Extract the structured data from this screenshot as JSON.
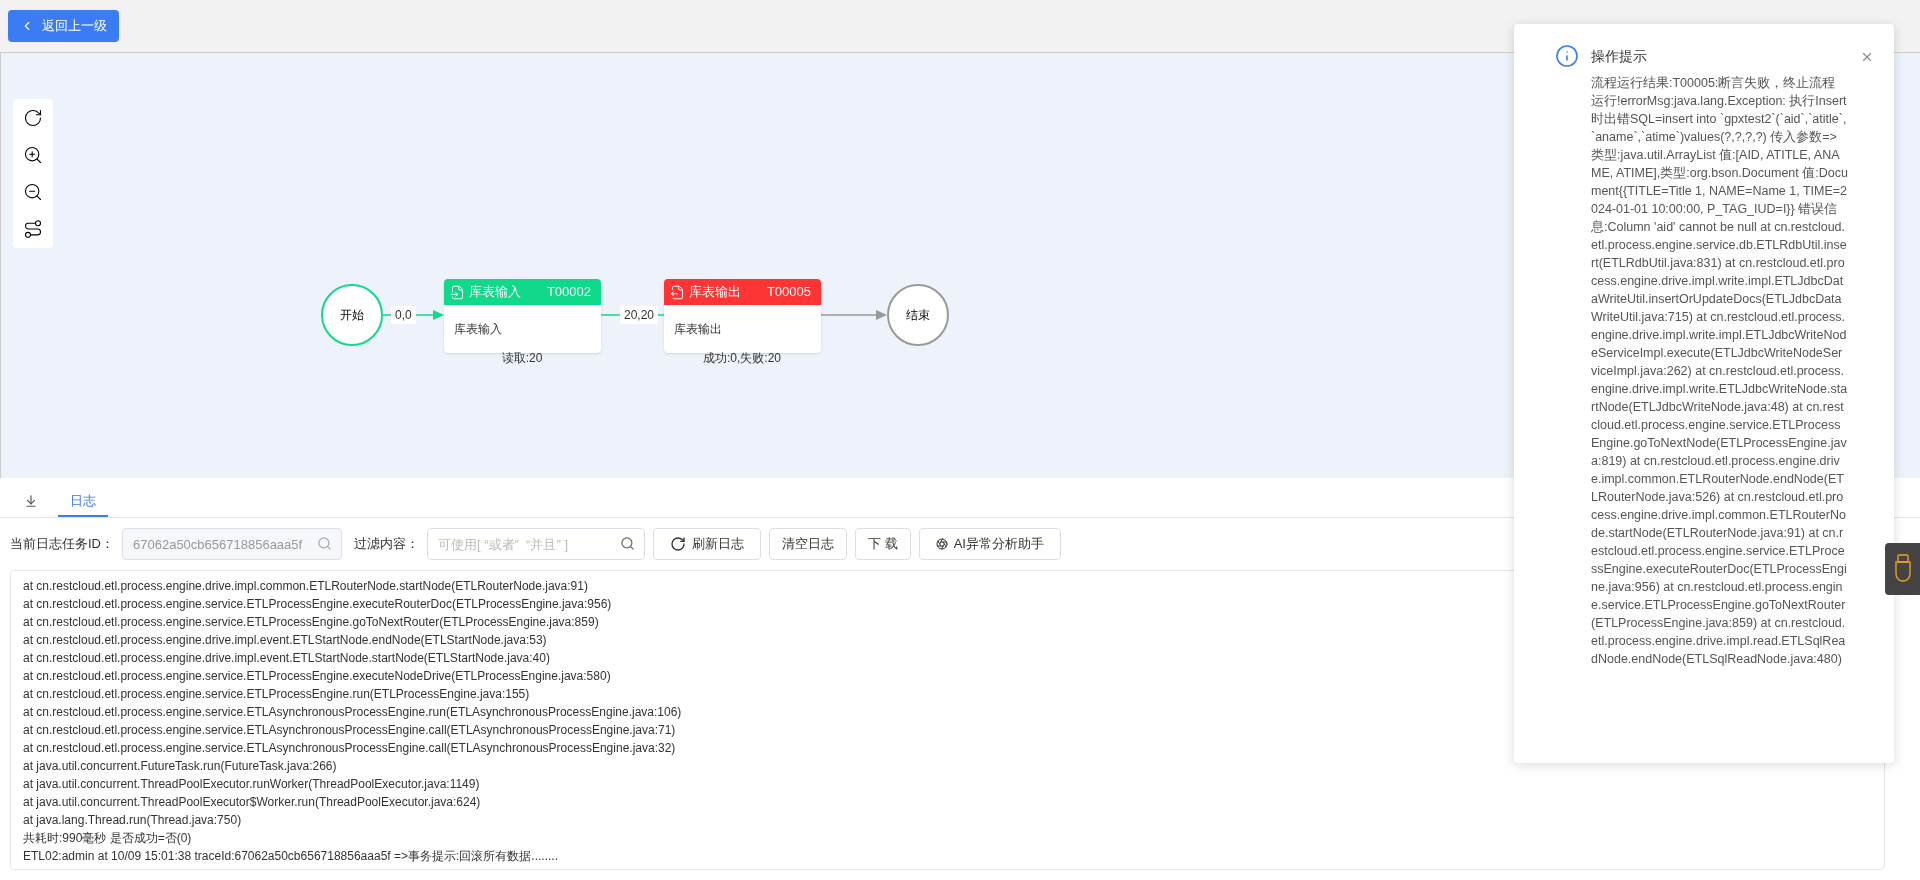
{
  "back_button": {
    "label": "返回上一级"
  },
  "flow": {
    "start": {
      "label": "开始",
      "reached": true
    },
    "nodes": [
      {
        "title": "库表输入",
        "code": "T00002",
        "body": "库表输入",
        "stats": "读取:20",
        "failed": false,
        "kind": "input"
      },
      {
        "title": "库表输出",
        "code": "T00005",
        "body": "库表输出",
        "stats": "成功:0,失败:20",
        "failed": true,
        "kind": "output"
      }
    ],
    "edges": [
      {
        "label": "0,0",
        "active": true
      },
      {
        "label": "20,20",
        "active": true
      },
      {
        "active": false
      }
    ],
    "end": {
      "label": "结束",
      "reached": false
    }
  },
  "tabs": [
    {
      "kind": "icon",
      "selected": false
    },
    {
      "kind": "text",
      "label": "日志",
      "selected": true
    }
  ],
  "log_toolbar": {
    "task_id_label": "当前日志任务ID：",
    "task_id_value": "67062a50cb656718856aaa5f",
    "task_id_disabled": true,
    "filter_label": "过滤内容：",
    "filter_placeholder": "可使用[ “或者”  “并且” ]",
    "buttons": [
      {
        "label": "刷新日志",
        "kind": "refresh"
      },
      {
        "label": "清空日志",
        "kind": "plain"
      },
      {
        "label": "下 载",
        "kind": "plain"
      },
      {
        "label": "AI异常分析助手",
        "kind": "ai"
      }
    ]
  },
  "log_lines": [
    "at cn.restcloud.etl.process.engine.drive.impl.common.ETLRouterNode.startNode(ETLRouterNode.java:91)",
    "at cn.restcloud.etl.process.engine.service.ETLProcessEngine.executeRouterDoc(ETLProcessEngine.java:956)",
    "at cn.restcloud.etl.process.engine.service.ETLProcessEngine.goToNextRouter(ETLProcessEngine.java:859)",
    "at cn.restcloud.etl.process.engine.drive.impl.event.ETLStartNode.endNode(ETLStartNode.java:53)",
    "at cn.restcloud.etl.process.engine.drive.impl.event.ETLStartNode.startNode(ETLStartNode.java:40)",
    "at cn.restcloud.etl.process.engine.service.ETLProcessEngine.executeNodeDrive(ETLProcessEngine.java:580)",
    "at cn.restcloud.etl.process.engine.service.ETLProcessEngine.run(ETLProcessEngine.java:155)",
    "at cn.restcloud.etl.process.engine.service.ETLAsynchronousProcessEngine.run(ETLAsynchronousProcessEngine.java:106)",
    "at cn.restcloud.etl.process.engine.service.ETLAsynchronousProcessEngine.call(ETLAsynchronousProcessEngine.java:71)",
    "at cn.restcloud.etl.process.engine.service.ETLAsynchronousProcessEngine.call(ETLAsynchronousProcessEngine.java:32)",
    "at java.util.concurrent.FutureTask.run(FutureTask.java:266)",
    "at java.util.concurrent.ThreadPoolExecutor.runWorker(ThreadPoolExecutor.java:1149)",
    "at java.util.concurrent.ThreadPoolExecutor$Worker.run(ThreadPoolExecutor.java:624)",
    "at java.lang.Thread.run(Thread.java:750)",
    "共耗时:990毫秒 是否成功=否(0)",
    "ETL02:admin at 10/09 15:01:38 traceId:67062a50cb656718856aaa5f =>事务提示:回滚所有数据........"
  ],
  "notification": {
    "title": "操作提示",
    "message": "流程运行结果:T00005:断言失败，终止流程运行!errorMsg:java.lang.Exception: 执行Insert时出错SQL=insert into `gpxtest2`(`aid`,`atitle`,`aname`,`atime`)values(?,?,?,?) 传入参数=>类型:java.util.ArrayList 值:[AID, ATITLE, ANAME, ATIME],类型:org.bson.Document 值:Document{{TITLE=Title 1, NAME=Name 1, TIME=2024-01-01 10:00:00, P_TAG_IUD=I}} 错误信息:Column 'aid' cannot be null at cn.restcloud.etl.process.engine.service.db.ETLRdbUtil.insert(ETLRdbUtil.java:831) at cn.restcloud.etl.process.engine.drive.impl.write.impl.ETLJdbcDataWriteUtil.insertOrUpdateDocs(ETLJdbcDataWriteUtil.java:715) at cn.restcloud.etl.process.engine.drive.impl.write.impl.ETLJdbcWriteNodeServiceImpl.execute(ETLJdbcWriteNodeServiceImpl.java:262) at cn.restcloud.etl.process.engine.drive.impl.write.ETLJdbcWriteNode.startNode(ETLJdbcWriteNode.java:48) at cn.restcloud.etl.process.engine.service.ETLProcessEngine.goToNextNode(ETLProcessEngine.java:819) at cn.restcloud.etl.process.engine.drive.impl.common.ETLRouterNode.endNode(ETLRouterNode.java:526) at cn.restcloud.etl.process.engine.drive.impl.common.ETLRouterNode.startNode(ETLRouterNode.java:91) at cn.restcloud.etl.process.engine.service.ETLProcessEngine.executeRouterDoc(ETLProcessEngine.java:956) at cn.restcloud.etl.process.engine.service.ETLProcessEngine.goToNextRouter(ETLProcessEngine.java:859) at cn.restcloud.etl.process.engine.drive.impl.read.ETLSqlReadNode.endNode(ETLSqlReadNode.java:480)"
  }
}
